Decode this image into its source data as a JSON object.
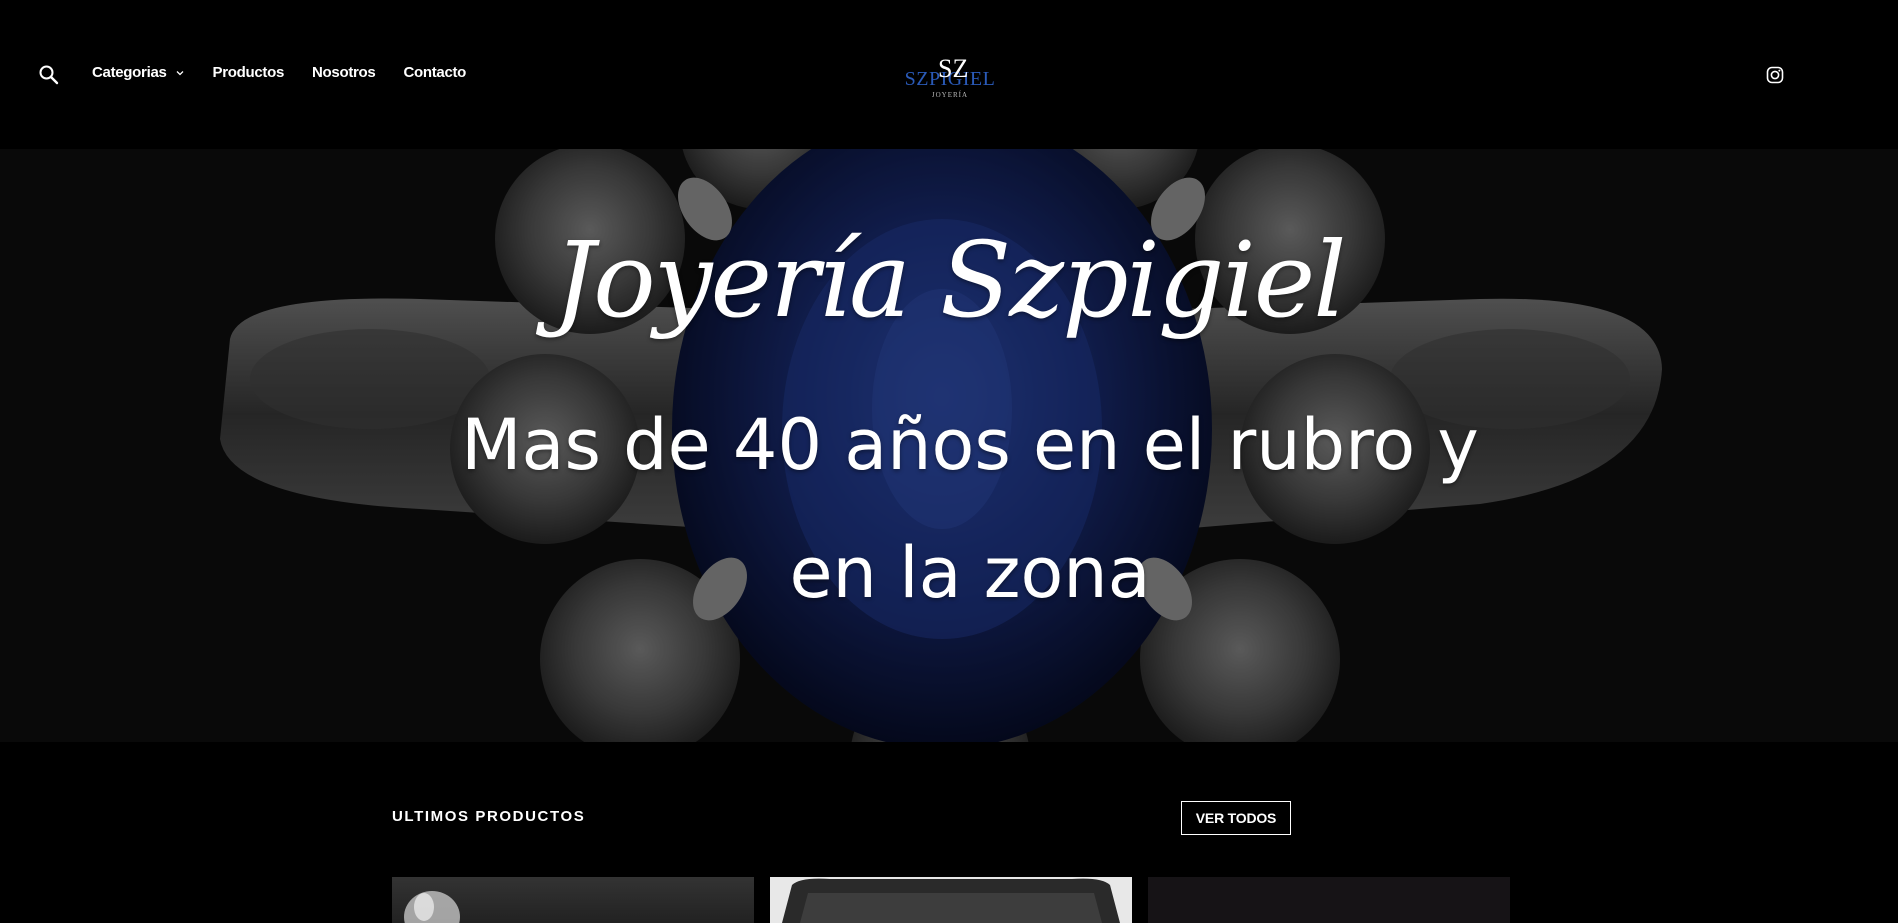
{
  "header": {
    "nav": {
      "categories_label": "Categorias",
      "products_label": "Productos",
      "about_label": "Nosotros",
      "contact_label": "Contacto"
    },
    "logo": {
      "text": "SZPIGIEL",
      "monogram": "SZ",
      "subtext": "JOYERÍA"
    }
  },
  "hero": {
    "script_title": "Joyería Szpigiel",
    "subtitle": "Mas de 40 años en el rubro y en la zona"
  },
  "products": {
    "section_title": "ULTIMOS PRODUCTOS",
    "view_all_label": "VER TODOS"
  },
  "colors": {
    "background": "#000000",
    "logo_blue": "#2a5ab8",
    "hero_sapphire": "#1b2f7a"
  },
  "icons": {
    "search": "search-icon",
    "instagram": "instagram-icon",
    "dropdown": "chevron-down-icon"
  }
}
